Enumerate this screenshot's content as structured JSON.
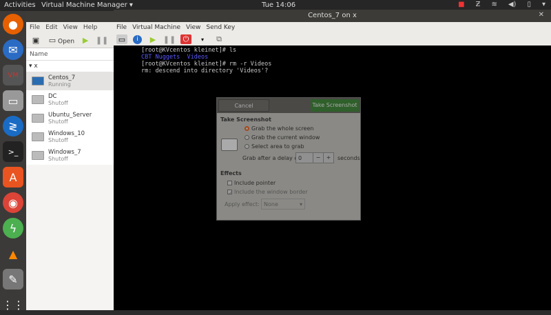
{
  "topbar": {
    "activities": "Activities",
    "app": "Virtual Machine Manager ▾",
    "clock": "Tue 14:06"
  },
  "vmm": {
    "menu": [
      "File",
      "Edit",
      "View",
      "Help"
    ],
    "open": "Open",
    "name_header": "Name",
    "group": "x",
    "vms": [
      {
        "name": "Centos_7",
        "status": "Running"
      },
      {
        "name": "DC",
        "status": "Shutoff"
      },
      {
        "name": "Ubuntu_Server",
        "status": "Shutoff"
      },
      {
        "name": "Windows_10",
        "status": "Shutoff"
      },
      {
        "name": "Windows_7",
        "status": "Shutoff"
      }
    ]
  },
  "console": {
    "title": "Centos_7 on x",
    "menu": [
      "File",
      "Virtual Machine",
      "View",
      "Send Key"
    ],
    "lines": [
      "[root@KVcentos kleinet]# ls",
      "CBT Nuggets  Videos",
      "[root@KVcentos kleinet]# rm -r Videos",
      "rm: descend into directory 'Videos'?"
    ]
  },
  "dialog": {
    "cancel": "Cancel",
    "take": "Take Screenshot",
    "section1": "Take Screenshot",
    "opt1": "Grab the whole screen",
    "opt2": "Grab the current window",
    "opt3": "Select area to grab",
    "delay_label": "Grab after a delay of",
    "delay_value": "0",
    "seconds": "seconds",
    "section2": "Effects",
    "pointer": "Include pointer",
    "border": "Include the window border",
    "effect_label": "Apply effect:",
    "effect_value": "None"
  }
}
